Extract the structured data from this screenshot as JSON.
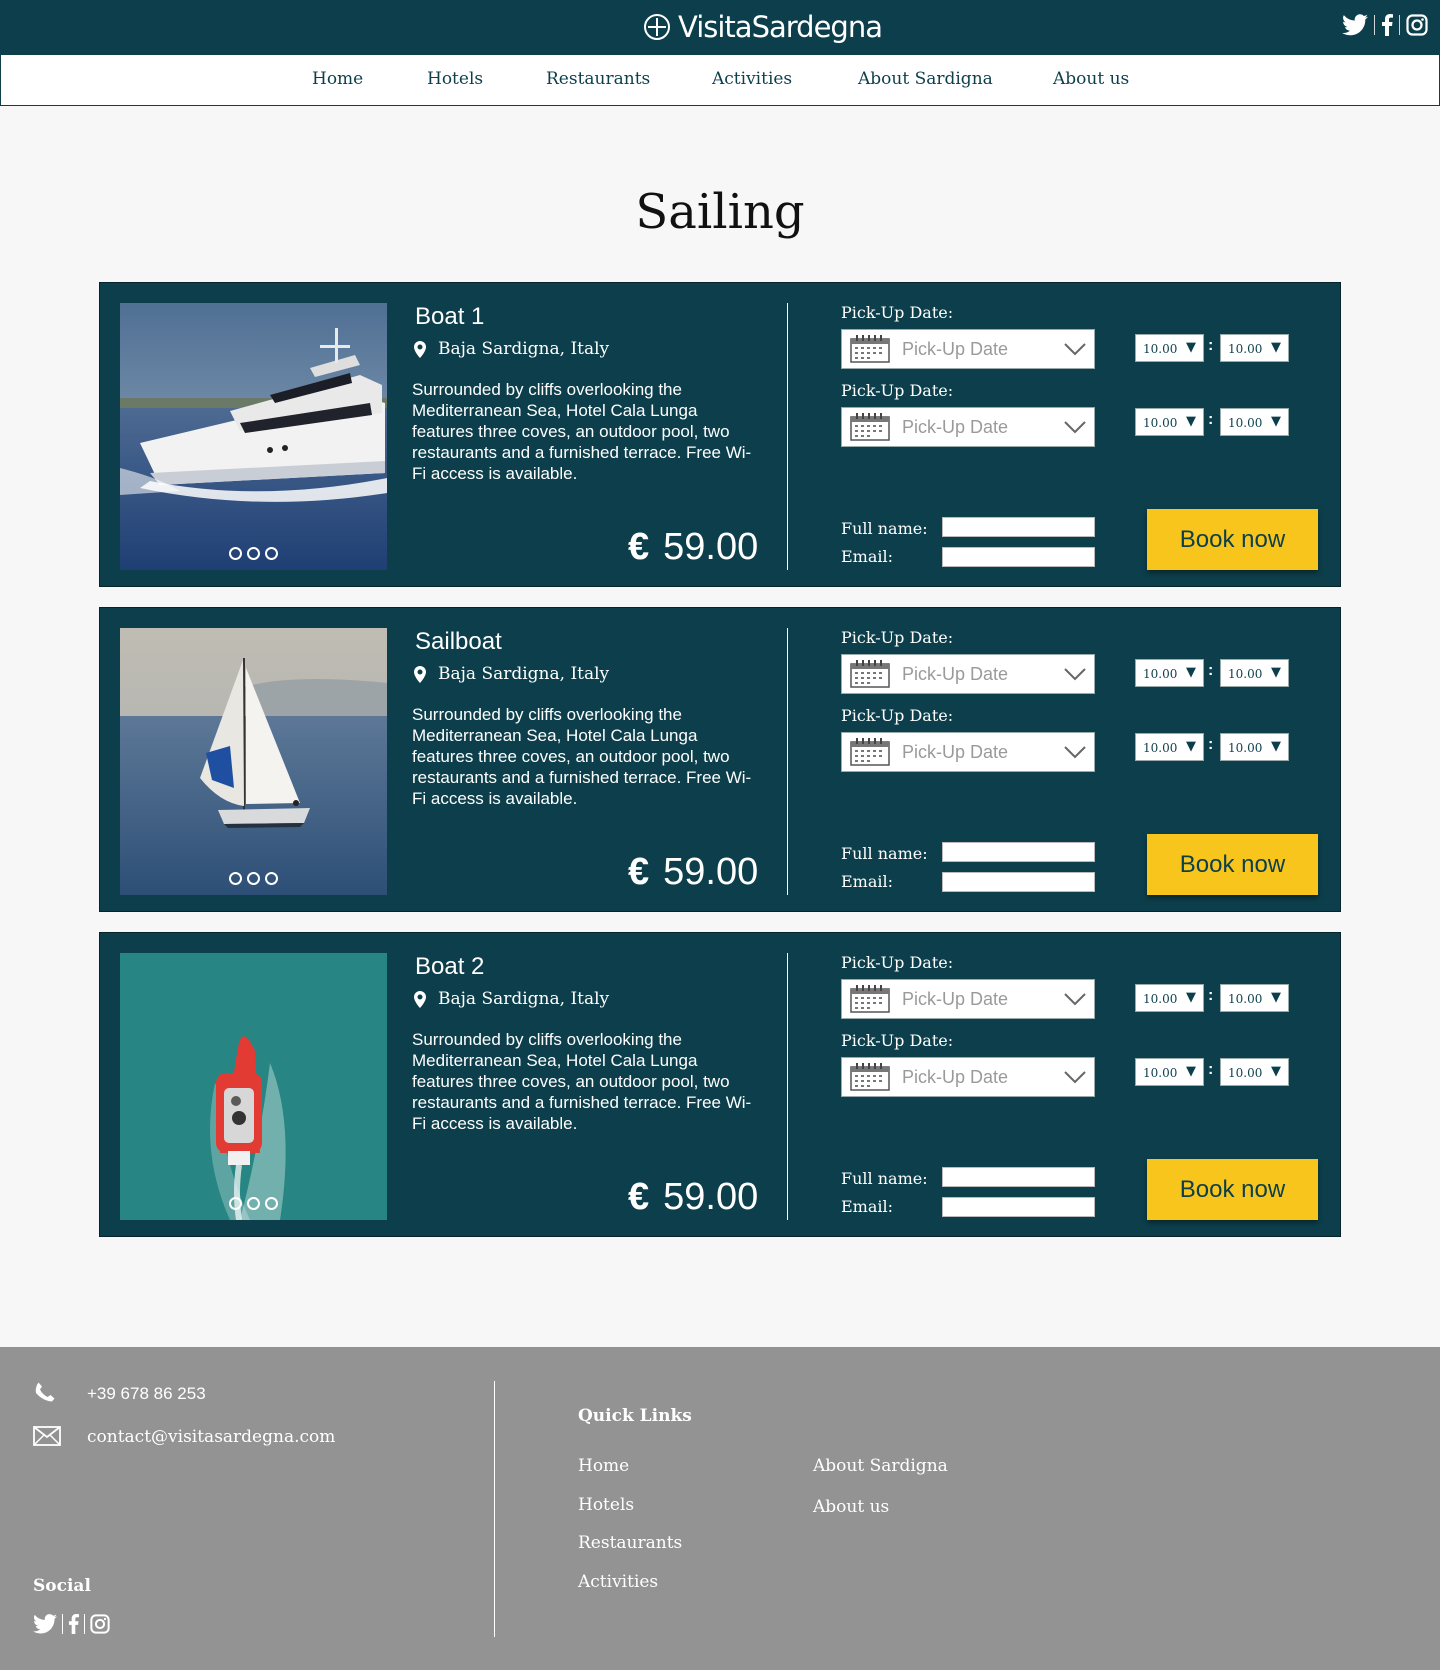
{
  "header": {
    "brand": "VisitaSardegna",
    "social": [
      "twitter-icon",
      "facebook-icon",
      "instagram-icon"
    ]
  },
  "nav": [
    "Home",
    "Hotels",
    "Restaurants",
    "Activities",
    "About Sardigna",
    "About us"
  ],
  "page_title": "Sailing",
  "cards": [
    {
      "title": "Boat 1",
      "location": "Baja Sardigna, Italy",
      "description": "Surrounded by cliffs overlooking the Mediterranean Sea, Hotel Cala Lunga features three coves, an outdoor pool, two restaurants and a furnished terrace. Free Wi-Fi access is available.",
      "currency": "€",
      "price": "59.00",
      "pickup_label_1": "Pick-Up Date:",
      "pickup_placeholder_1": "Pick-Up Date",
      "pickup_label_2": "Pick-Up Date:",
      "pickup_placeholder_2": "Pick-Up Date",
      "time_1a": "10.00",
      "time_1b": "10.00",
      "time_2a": "10.00",
      "time_2b": "10.00",
      "name_label": "Full name:",
      "email_label": "Email:",
      "book_label": "Book now"
    },
    {
      "title": "Sailboat",
      "location": "Baja Sardigna, Italy",
      "description": "Surrounded by cliffs overlooking the Mediterranean Sea, Hotel Cala Lunga features three coves, an outdoor pool, two restaurants and a furnished terrace. Free Wi-Fi access is available.",
      "currency": "€",
      "price": "59.00",
      "pickup_label_1": "Pick-Up Date:",
      "pickup_placeholder_1": "Pick-Up Date",
      "pickup_label_2": "Pick-Up Date:",
      "pickup_placeholder_2": "Pick-Up Date",
      "time_1a": "10.00",
      "time_1b": "10.00",
      "time_2a": "10.00",
      "time_2b": "10.00",
      "name_label": "Full name:",
      "email_label": "Email:",
      "book_label": "Book now"
    },
    {
      "title": "Boat 2",
      "location": "Baja Sardigna, Italy",
      "description": "Surrounded by cliffs overlooking the Mediterranean Sea, Hotel Cala Lunga features three coves, an outdoor pool, two restaurants and a furnished terrace. Free Wi-Fi access is available.",
      "currency": "€",
      "price": "59.00",
      "pickup_label_1": "Pick-Up Date:",
      "pickup_placeholder_1": "Pick-Up Date",
      "pickup_label_2": "Pick-Up Date:",
      "pickup_placeholder_2": "Pick-Up Date",
      "time_1a": "10.00",
      "time_1b": "10.00",
      "time_2a": "10.00",
      "time_2b": "10.00",
      "name_label": "Full name:",
      "email_label": "Email:",
      "book_label": "Book now"
    }
  ],
  "footer": {
    "phone": "+39 678 86 253",
    "email": "contact@visitasardegna.com",
    "social_title": "Social",
    "quick_links_title": "Quick Links",
    "links_col1": [
      "Home",
      "Hotels",
      "Restaurants",
      "Activities"
    ],
    "links_col2": [
      "About Sardigna",
      "About us"
    ]
  },
  "colors": {
    "primary": "#0c3f4b",
    "accent": "#f7c51c",
    "footer": "#939393",
    "background": "#f7f7f7"
  }
}
